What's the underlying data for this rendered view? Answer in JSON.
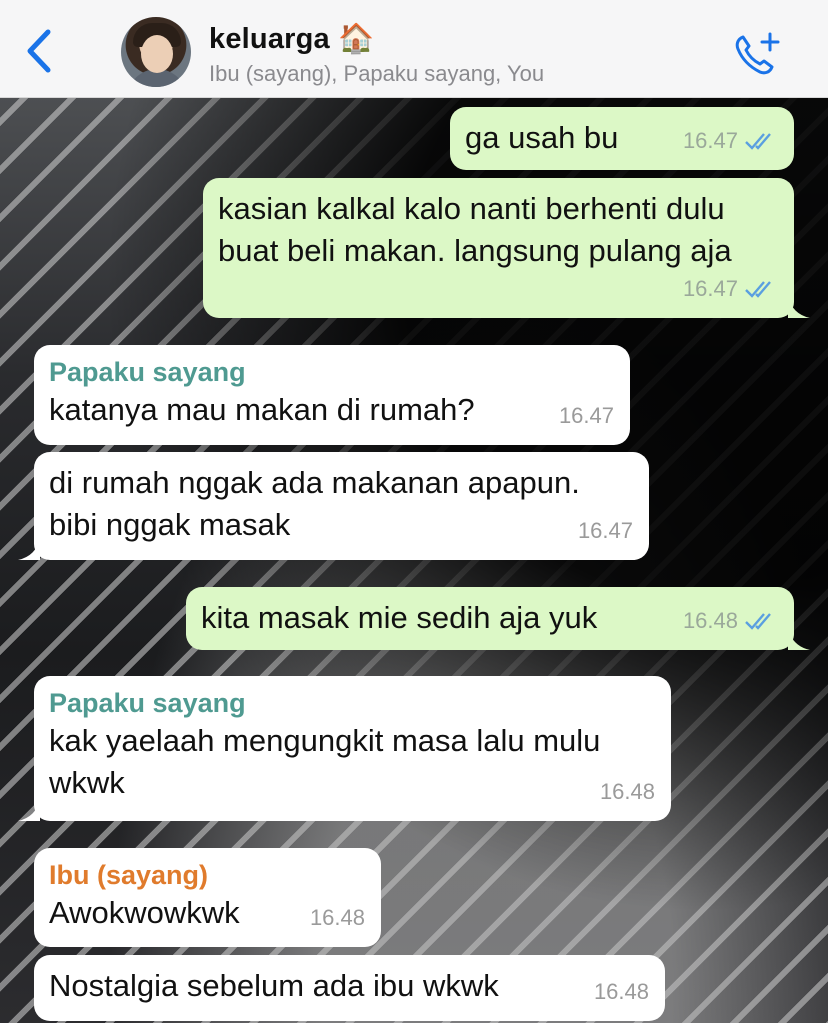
{
  "header": {
    "title": "keluarga 🏠",
    "subtitle": "Ibu (sayang), Papaku sayang, You"
  },
  "colors": {
    "accent": "#1a73e8",
    "outgoing_bubble": "#dcf8c6",
    "incoming_bubble": "#ffffff",
    "sender_papa": "#4f9a91",
    "sender_ibu": "#e07b2c",
    "read_checks": "#5a9fe0"
  },
  "icons": {
    "back": "chevron-left-icon",
    "call": "phone-plus-icon"
  },
  "messages": [
    {
      "direction": "out",
      "text": "ga usah bu",
      "time": "16.47",
      "read": true
    },
    {
      "direction": "out",
      "text": "kasian kalkal kalo nanti berhenti dulu buat beli makan. langsung pulang aja",
      "time": "16.47",
      "read": true
    },
    {
      "direction": "in",
      "sender": "Papaku sayang",
      "text": "katanya mau makan di rumah?",
      "time": "16.47"
    },
    {
      "direction": "in",
      "text": "di rumah nggak ada makanan apapun. bibi nggak masak",
      "time": "16.47"
    },
    {
      "direction": "out",
      "text": "kita masak mie sedih aja yuk",
      "time": "16.48",
      "read": true
    },
    {
      "direction": "in",
      "sender": "Papaku sayang",
      "text": "kak yaelaah mengungkit masa lalu mulu wkwk",
      "time": "16.48"
    },
    {
      "direction": "in",
      "sender": "Ibu (sayang)",
      "text": "Awokwowkwk",
      "time": "16.48"
    },
    {
      "direction": "in",
      "text": "Nostalgia sebelum ada ibu wkwk",
      "time": "16.48"
    }
  ]
}
